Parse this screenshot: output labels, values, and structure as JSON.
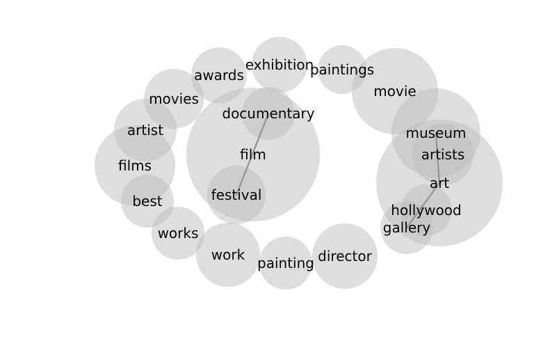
{
  "words": [
    {
      "id": "film",
      "label": "film"
    },
    {
      "id": "documentary",
      "label": "documentary"
    },
    {
      "id": "festival",
      "label": "festival"
    },
    {
      "id": "art",
      "label": "art"
    },
    {
      "id": "museum",
      "label": "museum"
    },
    {
      "id": "artists",
      "label": "artists"
    },
    {
      "id": "hollywood",
      "label": "hollywood"
    },
    {
      "id": "gallery",
      "label": "gallery"
    },
    {
      "id": "movie",
      "label": "movie"
    },
    {
      "id": "exhibition",
      "label": "exhibition"
    },
    {
      "id": "paintings",
      "label": "paintings"
    },
    {
      "id": "awards",
      "label": "awards"
    },
    {
      "id": "movies",
      "label": "movies"
    },
    {
      "id": "artist",
      "label": "artist"
    },
    {
      "id": "films",
      "label": "films"
    },
    {
      "id": "best",
      "label": "best"
    },
    {
      "id": "works",
      "label": "works"
    },
    {
      "id": "work",
      "label": "work"
    },
    {
      "id": "painting",
      "label": "painting"
    },
    {
      "id": "director",
      "label": "director"
    }
  ],
  "links": [
    {
      "from": "documentary",
      "to": "festival"
    },
    {
      "from": "museum",
      "to": "art"
    },
    {
      "from": "art",
      "to": "gallery"
    }
  ]
}
